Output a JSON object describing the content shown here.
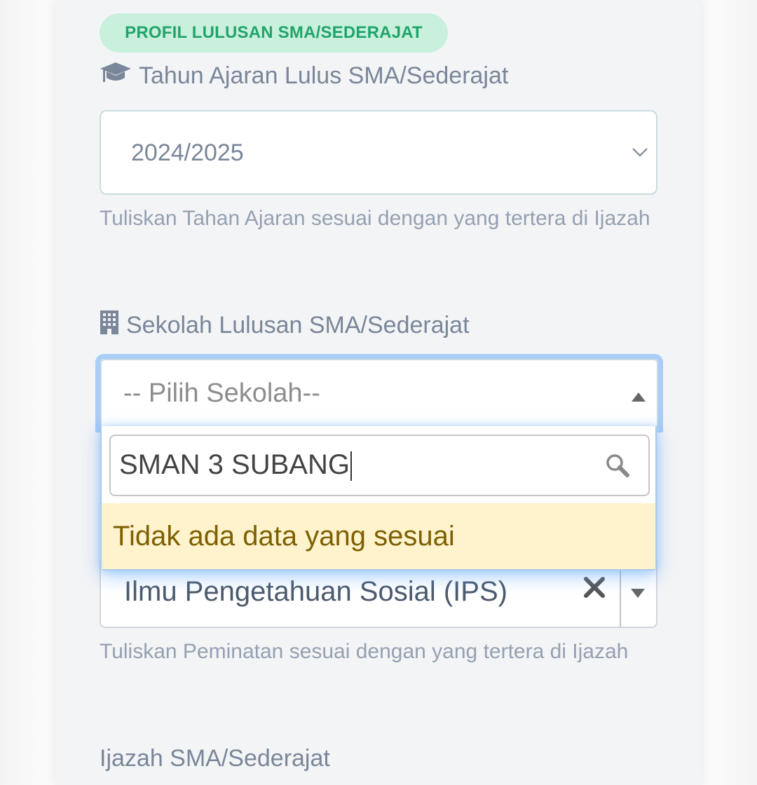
{
  "section_badge": "PROFIL LULUSAN SMA/SEDERAJAT",
  "tahun_ajaran": {
    "label": "Tahun Ajaran Lulus SMA/Sederajat",
    "value": "2024/2025",
    "help": "Tuliskan Tahan Ajaran sesuai dengan yang tertera di Ijazah",
    "icon": "graduation-cap-icon"
  },
  "sekolah": {
    "label": "Sekolah Lulusan SMA/Sederajat",
    "placeholder": "-- Pilih Sekolah--",
    "icon": "building-icon",
    "dropdown": {
      "search_value": "SMAN 3 SUBANG",
      "no_result": "Tidak ada data yang sesuai"
    }
  },
  "peminatan": {
    "value": "Ilmu Pengetahuan Sosial (IPS)",
    "help": "Tuliskan Peminatan sesuai dengan yang tertera di Ijazah"
  },
  "ijazah": {
    "label": "Ijazah SMA/Sederajat"
  },
  "colors": {
    "badge_bg": "#c8f0dd",
    "badge_text": "#21a46a",
    "focus_ring": "#a9cdf6",
    "no_result_bg": "#fff3cd",
    "no_result_text": "#7d6002"
  }
}
